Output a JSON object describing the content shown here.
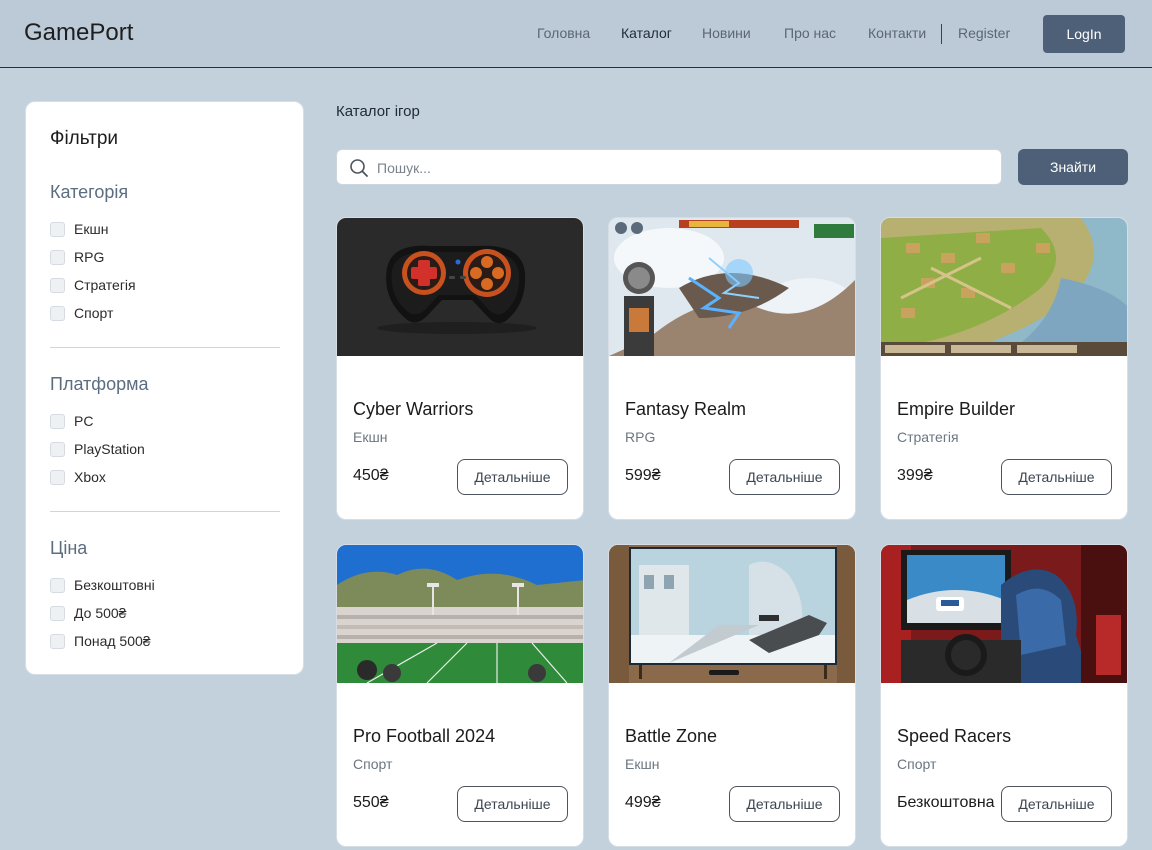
{
  "header": {
    "logo": "GamePort",
    "nav": [
      {
        "label": "Головна"
      },
      {
        "label": "Каталог"
      },
      {
        "label": "Новини"
      },
      {
        "label": "Про нас"
      },
      {
        "label": "Контакти"
      },
      {
        "label": "Register"
      }
    ],
    "login_label": "LogIn"
  },
  "filters": {
    "title": "Фільтри",
    "groups": [
      {
        "title": "Категорія",
        "options": [
          "Екшн",
          "RPG",
          "Стратегія",
          "Спорт"
        ]
      },
      {
        "title": "Платформа",
        "options": [
          "PC",
          "PlayStation",
          "Xbox"
        ]
      },
      {
        "title": "Ціна",
        "options": [
          "Безкоштовні",
          "До 500₴",
          "Понад 500₴"
        ]
      }
    ]
  },
  "catalog": {
    "title": "Каталог ігор",
    "search_placeholder": "Пошук...",
    "search_button": "Знайти",
    "details_label": "Детальніше",
    "games": [
      {
        "title": "Cyber Warriors",
        "genre": "Екшн",
        "price": "450₴"
      },
      {
        "title": "Fantasy Realm",
        "genre": "RPG",
        "price": "599₴"
      },
      {
        "title": "Empire Builder",
        "genre": "Стратегія",
        "price": "399₴"
      },
      {
        "title": "Pro Football 2024",
        "genre": "Спорт",
        "price": "550₴"
      },
      {
        "title": "Battle Zone",
        "genre": "Екшн",
        "price": "499₴"
      },
      {
        "title": "Speed Racers",
        "genre": "Спорт",
        "price": "Безкоштовна"
      }
    ]
  },
  "colors": {
    "page_bg": "#c3d1dc",
    "header_bg": "#bccad8",
    "accent": "#4e6078",
    "group_title": "#5b6d80"
  }
}
